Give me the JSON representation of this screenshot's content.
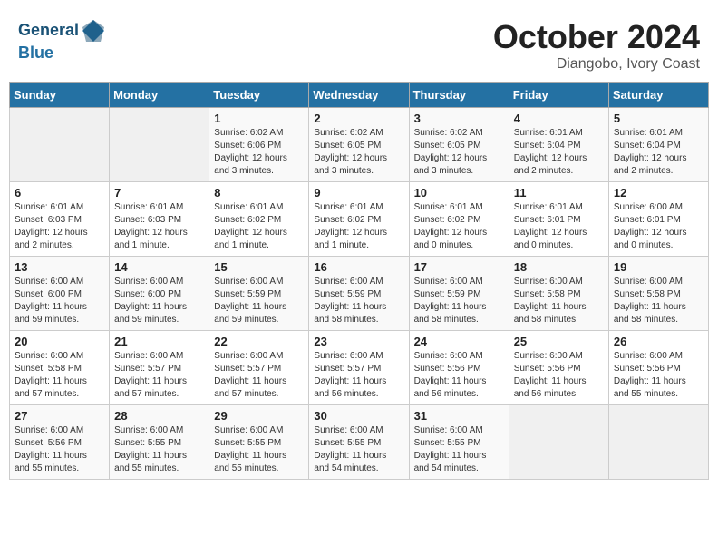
{
  "header": {
    "logo_line1": "General",
    "logo_line2": "Blue",
    "title": "October 2024",
    "subtitle": "Diangobo, Ivory Coast"
  },
  "weekdays": [
    "Sunday",
    "Monday",
    "Tuesday",
    "Wednesday",
    "Thursday",
    "Friday",
    "Saturday"
  ],
  "weeks": [
    [
      {
        "day": "",
        "detail": ""
      },
      {
        "day": "",
        "detail": ""
      },
      {
        "day": "1",
        "detail": "Sunrise: 6:02 AM\nSunset: 6:06 PM\nDaylight: 12 hours and 3 minutes."
      },
      {
        "day": "2",
        "detail": "Sunrise: 6:02 AM\nSunset: 6:05 PM\nDaylight: 12 hours and 3 minutes."
      },
      {
        "day": "3",
        "detail": "Sunrise: 6:02 AM\nSunset: 6:05 PM\nDaylight: 12 hours and 3 minutes."
      },
      {
        "day": "4",
        "detail": "Sunrise: 6:01 AM\nSunset: 6:04 PM\nDaylight: 12 hours and 2 minutes."
      },
      {
        "day": "5",
        "detail": "Sunrise: 6:01 AM\nSunset: 6:04 PM\nDaylight: 12 hours and 2 minutes."
      }
    ],
    [
      {
        "day": "6",
        "detail": "Sunrise: 6:01 AM\nSunset: 6:03 PM\nDaylight: 12 hours and 2 minutes."
      },
      {
        "day": "7",
        "detail": "Sunrise: 6:01 AM\nSunset: 6:03 PM\nDaylight: 12 hours and 1 minute."
      },
      {
        "day": "8",
        "detail": "Sunrise: 6:01 AM\nSunset: 6:02 PM\nDaylight: 12 hours and 1 minute."
      },
      {
        "day": "9",
        "detail": "Sunrise: 6:01 AM\nSunset: 6:02 PM\nDaylight: 12 hours and 1 minute."
      },
      {
        "day": "10",
        "detail": "Sunrise: 6:01 AM\nSunset: 6:02 PM\nDaylight: 12 hours and 0 minutes."
      },
      {
        "day": "11",
        "detail": "Sunrise: 6:01 AM\nSunset: 6:01 PM\nDaylight: 12 hours and 0 minutes."
      },
      {
        "day": "12",
        "detail": "Sunrise: 6:00 AM\nSunset: 6:01 PM\nDaylight: 12 hours and 0 minutes."
      }
    ],
    [
      {
        "day": "13",
        "detail": "Sunrise: 6:00 AM\nSunset: 6:00 PM\nDaylight: 11 hours and 59 minutes."
      },
      {
        "day": "14",
        "detail": "Sunrise: 6:00 AM\nSunset: 6:00 PM\nDaylight: 11 hours and 59 minutes."
      },
      {
        "day": "15",
        "detail": "Sunrise: 6:00 AM\nSunset: 5:59 PM\nDaylight: 11 hours and 59 minutes."
      },
      {
        "day": "16",
        "detail": "Sunrise: 6:00 AM\nSunset: 5:59 PM\nDaylight: 11 hours and 58 minutes."
      },
      {
        "day": "17",
        "detail": "Sunrise: 6:00 AM\nSunset: 5:59 PM\nDaylight: 11 hours and 58 minutes."
      },
      {
        "day": "18",
        "detail": "Sunrise: 6:00 AM\nSunset: 5:58 PM\nDaylight: 11 hours and 58 minutes."
      },
      {
        "day": "19",
        "detail": "Sunrise: 6:00 AM\nSunset: 5:58 PM\nDaylight: 11 hours and 58 minutes."
      }
    ],
    [
      {
        "day": "20",
        "detail": "Sunrise: 6:00 AM\nSunset: 5:58 PM\nDaylight: 11 hours and 57 minutes."
      },
      {
        "day": "21",
        "detail": "Sunrise: 6:00 AM\nSunset: 5:57 PM\nDaylight: 11 hours and 57 minutes."
      },
      {
        "day": "22",
        "detail": "Sunrise: 6:00 AM\nSunset: 5:57 PM\nDaylight: 11 hours and 57 minutes."
      },
      {
        "day": "23",
        "detail": "Sunrise: 6:00 AM\nSunset: 5:57 PM\nDaylight: 11 hours and 56 minutes."
      },
      {
        "day": "24",
        "detail": "Sunrise: 6:00 AM\nSunset: 5:56 PM\nDaylight: 11 hours and 56 minutes."
      },
      {
        "day": "25",
        "detail": "Sunrise: 6:00 AM\nSunset: 5:56 PM\nDaylight: 11 hours and 56 minutes."
      },
      {
        "day": "26",
        "detail": "Sunrise: 6:00 AM\nSunset: 5:56 PM\nDaylight: 11 hours and 55 minutes."
      }
    ],
    [
      {
        "day": "27",
        "detail": "Sunrise: 6:00 AM\nSunset: 5:56 PM\nDaylight: 11 hours and 55 minutes."
      },
      {
        "day": "28",
        "detail": "Sunrise: 6:00 AM\nSunset: 5:55 PM\nDaylight: 11 hours and 55 minutes."
      },
      {
        "day": "29",
        "detail": "Sunrise: 6:00 AM\nSunset: 5:55 PM\nDaylight: 11 hours and 55 minutes."
      },
      {
        "day": "30",
        "detail": "Sunrise: 6:00 AM\nSunset: 5:55 PM\nDaylight: 11 hours and 54 minutes."
      },
      {
        "day": "31",
        "detail": "Sunrise: 6:00 AM\nSunset: 5:55 PM\nDaylight: 11 hours and 54 minutes."
      },
      {
        "day": "",
        "detail": ""
      },
      {
        "day": "",
        "detail": ""
      }
    ]
  ]
}
